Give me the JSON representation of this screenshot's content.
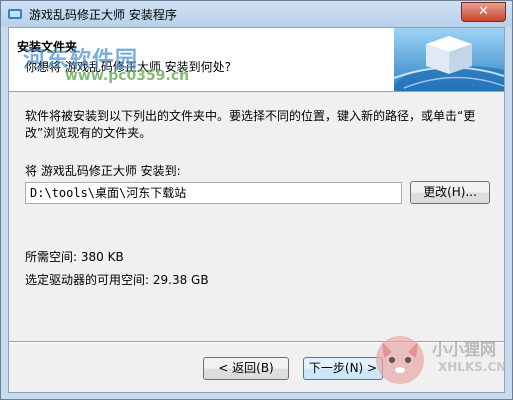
{
  "window": {
    "title": "游戏乱码修正大师 安装程序",
    "close_label": "✕"
  },
  "header": {
    "title": "安装文件夹",
    "subtitle": "你想将 游戏乱码修正大师 安装到何处?"
  },
  "main": {
    "description": "软件将被安装到以下列出的文件夹中。要选择不同的位置，键入新的路径，或单击“更改”浏览现有的文件夹。",
    "install_label": "将 游戏乱码修正大师 安装到:",
    "install_path": "D:\\tools\\桌面\\河东下载站",
    "browse_label": "更改(H)...",
    "space_required": "所需空间: 380 KB",
    "space_available": "选定驱动器的可用空间: 29.38 GB"
  },
  "footer": {
    "back_label": "< 返回(B)",
    "next_label": "下一步(N) >"
  },
  "watermarks": {
    "top_brand": "河东软件园",
    "top_url": "www.pc0359.cn",
    "bottom_brand": "小小狸网",
    "bottom_url": "XHLKS.CN"
  },
  "icons": {
    "app": "installer-icon",
    "header_graphic": "cube-globe-graphic"
  },
  "colors": {
    "titlebar": "#c7daee",
    "close_button": "#c8442f",
    "header_bg": "#ffffff",
    "dialog_bg": "#f0f0f0"
  }
}
